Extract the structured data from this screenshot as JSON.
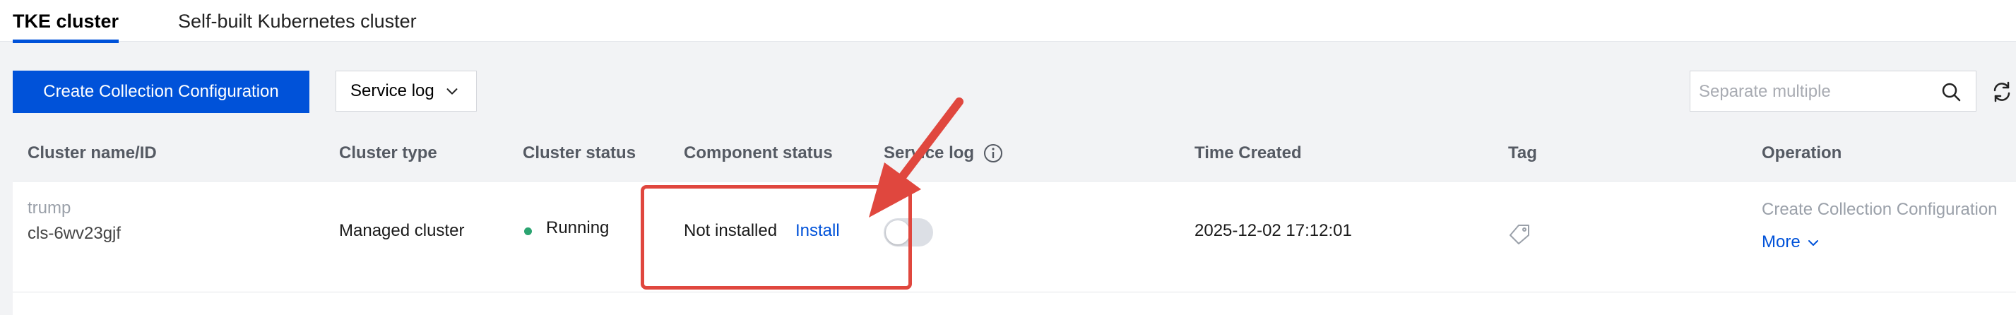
{
  "tabs": [
    {
      "label": "TKE cluster",
      "active": true
    },
    {
      "label": "Self-built Kubernetes cluster",
      "active": false
    }
  ],
  "toolbar": {
    "create_button": "Create Collection Configuration",
    "log_type_select": "Service log",
    "search_placeholder": "Separate multiple"
  },
  "table": {
    "columns": [
      "Cluster name/ID",
      "Cluster type",
      "Cluster status",
      "Component status",
      "Service log",
      "Time Created",
      "Tag",
      "Operation"
    ],
    "rows": [
      {
        "cluster_name": "trump",
        "cluster_id": "cls-6wv23gjf",
        "cluster_type": "Managed cluster",
        "cluster_status": "Running",
        "component_status": "Not installed",
        "install_link": "Install",
        "service_log_enabled": false,
        "time_created": "2025-12-02 17:12:01",
        "operation_create": "Create Collection Configuration",
        "operation_more": "More"
      }
    ]
  },
  "colors": {
    "primary": "#0052d9",
    "success": "#2ba471",
    "annotation": "#e0473e"
  },
  "icons": [
    "chevron-down-icon",
    "search-icon",
    "refresh-icon",
    "info-icon",
    "tag-icon",
    "arrow-annotation"
  ]
}
